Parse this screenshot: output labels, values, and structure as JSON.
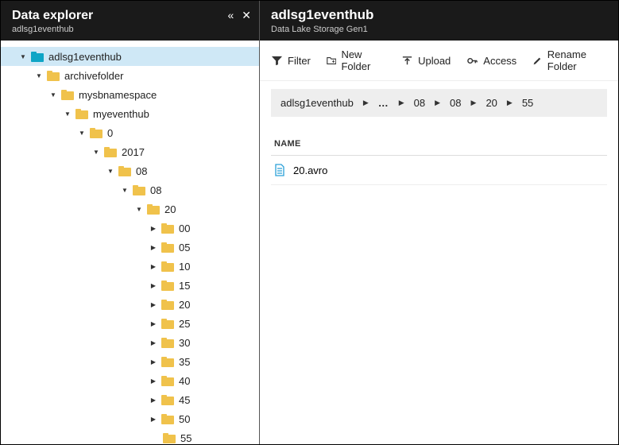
{
  "left": {
    "title": "Data explorer",
    "subtitle": "adlsg1eventhub"
  },
  "right": {
    "title": "adlsg1eventhub",
    "subtitle": "Data Lake Storage Gen1"
  },
  "toolbar": {
    "filter": "Filter",
    "new_folder": "New Folder",
    "upload": "Upload",
    "access": "Access",
    "rename": "Rename Folder"
  },
  "breadcrumb": {
    "root": "adlsg1eventhub",
    "parts": [
      "08",
      "08",
      "20",
      "55"
    ]
  },
  "columns": {
    "name": "NAME"
  },
  "files": [
    {
      "name": "20.avro"
    }
  ],
  "tree": {
    "root": "adlsg1eventhub",
    "l1": "archivefolder",
    "l2": "mysbnamespace",
    "l3": "myeventhub",
    "l4": "0",
    "l5": "2017",
    "l6": "08",
    "l7": "08",
    "l8": "20",
    "leaves": [
      "00",
      "05",
      "10",
      "15",
      "20",
      "25",
      "30",
      "35",
      "40",
      "45",
      "50",
      "55"
    ]
  }
}
